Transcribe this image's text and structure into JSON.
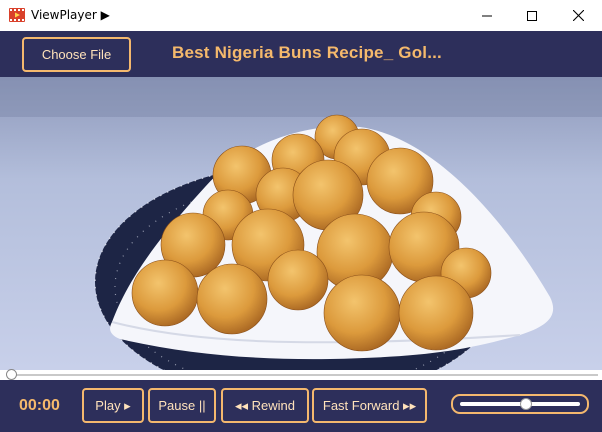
{
  "window": {
    "title": "ViewPlayer ▶",
    "icon": "film-play-icon",
    "controls": [
      "minimize-icon",
      "maximize-icon",
      "close-icon"
    ]
  },
  "toolbar": {
    "choose_file_label": "Choose File",
    "video_title": "Best Nigeria Buns Recipe_ Gol..."
  },
  "player": {
    "seek_position": 0
  },
  "controls": {
    "time": "00:00",
    "play_label": "Play ▸",
    "pause_label": "Pause ||",
    "rewind_label": "◂◂ Rewind",
    "fast_forward_label": "Fast Forward ▸▸",
    "volume": 0.55
  },
  "colors": {
    "background": "#2d2f5b",
    "accent": "#f4b86e",
    "button_text": "#ffe2bb"
  }
}
